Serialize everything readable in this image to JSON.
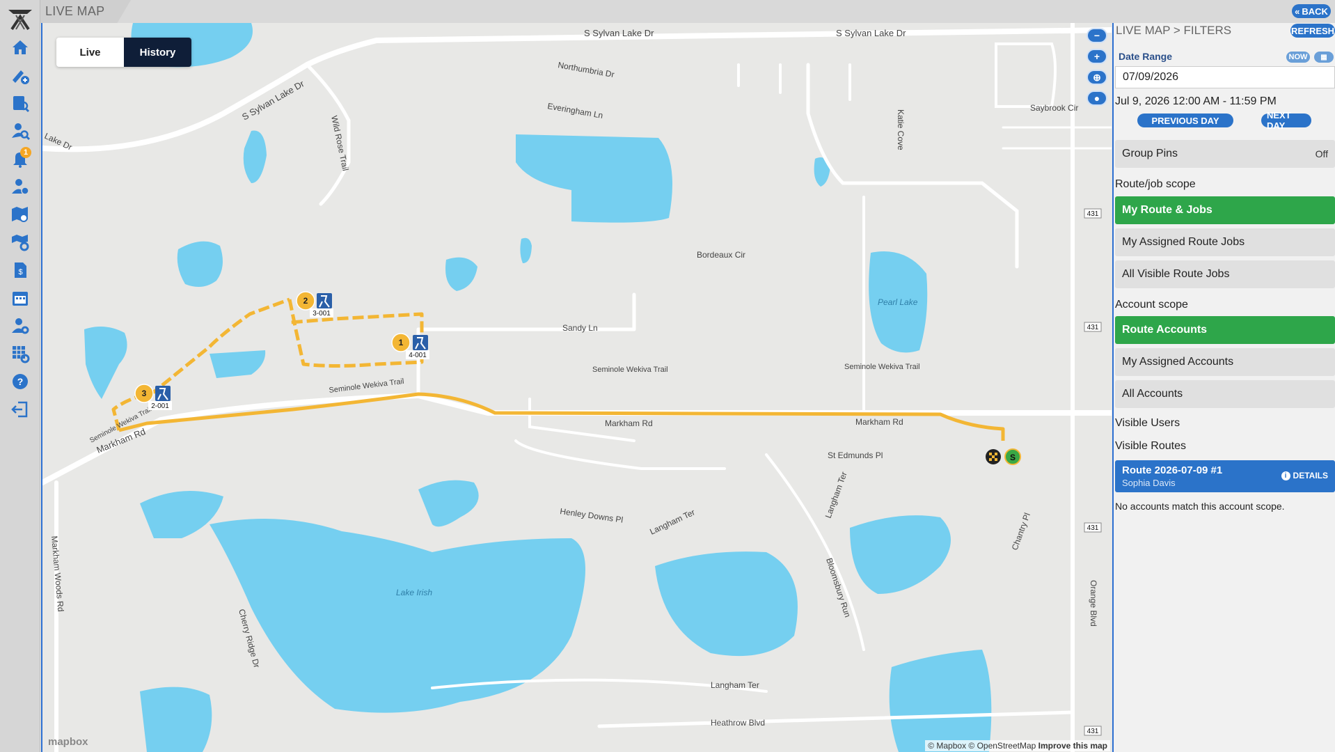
{
  "header": {
    "title": "LIVE MAP",
    "back_label": "BACK",
    "refresh_label": "REFRESH"
  },
  "sidebar": {
    "items": [
      {
        "icon": "home-icon"
      },
      {
        "icon": "pin-add-icon"
      },
      {
        "icon": "clipboard-search-icon"
      },
      {
        "icon": "user-search-icon"
      },
      {
        "icon": "bell-icon",
        "badge": "1"
      },
      {
        "icon": "user-add-icon"
      },
      {
        "icon": "map-search-icon"
      },
      {
        "icon": "map-settings-icon"
      },
      {
        "icon": "document-dollar-icon"
      },
      {
        "icon": "calendar-icon"
      },
      {
        "icon": "user-settings-icon"
      },
      {
        "icon": "grid-settings-icon"
      },
      {
        "icon": "help-icon"
      },
      {
        "icon": "logout-icon"
      }
    ]
  },
  "map": {
    "mode_live": "Live",
    "mode_history": "History",
    "mode_selected": "History",
    "streets": {
      "s_sylvan_1": "S Sylvan Lake Dr",
      "s_sylvan_2": "S Sylvan Lake Dr",
      "s_sylvan_3": "S Sylvan Lake Dr",
      "lake_dr": "Lake Dr",
      "northumbria": "Northumbria Dr",
      "everingham": "Everingham Ln",
      "wild_rose": "Wild Rose Trail",
      "katie_cove": "Katie Cove",
      "saybrook": "Saybrook Cir",
      "bordeaux": "Bordeaux Cir",
      "pearl_lake": "Pearl Lake",
      "sandy_ln": "Sandy Ln",
      "seminole_1": "Seminole Wekiva Trail",
      "seminole_2": "Seminole Wekiva Trail",
      "seminole_3": "Seminole Wekiva Trail",
      "seminole_4": "Seminole Wekiva Trail",
      "markham_1": "Markham Rd",
      "markham_2": "Markham Rd",
      "markham_3": "Markham Rd",
      "st_edmunds": "St Edmunds Pl",
      "henley": "Henley Downs Pl",
      "langham_ter_1": "Langham Ter",
      "langham_ter_2": "Langham Ter",
      "langham_ter_3": "Langham Ter",
      "bloomsbury": "Bloomsbury Run",
      "chantry": "Chantry Pl",
      "lake_irish": "Lake Irish",
      "cherry_ridge": "Cherry Ridge Dr",
      "markham_woods": "Markham Woods Rd",
      "heathrow": "Heathrow Blvd",
      "orange_blvd": "Orange Blvd",
      "shield_431": "431"
    },
    "stops": [
      {
        "num": "1",
        "label": "4-001"
      },
      {
        "num": "2",
        "label": "3-001"
      },
      {
        "num": "3",
        "label": "2-001"
      }
    ],
    "start_marker": "S",
    "mapbox_logo": "mapbox",
    "attribution": "© Mapbox © OpenStreetMap",
    "improve": "Improve this map",
    "route_color": "#f3b634",
    "water_color": "#75cff0"
  },
  "panel": {
    "breadcrumb": "LIVE MAP > FILTERS",
    "date_range_label": "Date Range",
    "now_label": "NOW",
    "date_value": "07/09/2026",
    "range_text": "Jul 9, 2026 12:00 AM - 11:59 PM",
    "prev_day": "PREVIOUS DAY",
    "next_day": "NEXT DAY",
    "group_pins_label": "Group Pins",
    "group_pins_value": "Off",
    "route_scope_title": "Route/job scope",
    "route_scope": [
      "My Route & Jobs",
      "My Assigned Route Jobs",
      "All Visible Route Jobs"
    ],
    "account_scope_title": "Account scope",
    "account_scope": [
      "Route Accounts",
      "My Assigned Accounts",
      "All Accounts"
    ],
    "visible_users": "Visible Users",
    "visible_routes": "Visible Routes",
    "route_card": {
      "title": "Route 2026-07-09 #1",
      "subtitle": "Sophia Davis",
      "details": "DETAILS"
    },
    "empty_note": "No accounts match this account scope.",
    "accent": "#2b73c9",
    "selected": "#2ea64a"
  }
}
